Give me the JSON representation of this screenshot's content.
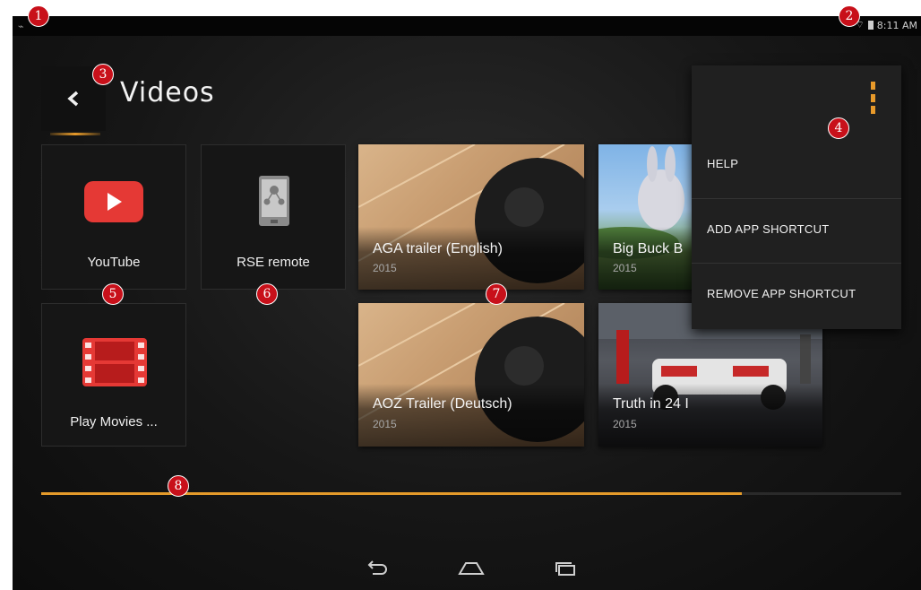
{
  "status_bar": {
    "time": "8:11 AM"
  },
  "header": {
    "title": "Videos"
  },
  "apps": [
    {
      "label": "YouTube",
      "icon": "youtube-icon"
    },
    {
      "label": "RSE remote",
      "icon": "rse-remote-icon"
    },
    {
      "label": "Play Movies ...",
      "icon": "film-icon"
    }
  ],
  "videos": [
    {
      "title": "AGA trailer (English)",
      "year": "2015"
    },
    {
      "title": "Big Buck B",
      "year": "2015"
    },
    {
      "title": "AOZ Trailer (Deutsch)",
      "year": "2015"
    },
    {
      "title": "Truth in 24 I",
      "year": "2015"
    }
  ],
  "menu": {
    "items": [
      {
        "label": "HELP"
      },
      {
        "label": "ADD APP SHORTCUT"
      },
      {
        "label": "REMOVE APP SHORTCUT"
      }
    ]
  },
  "scroll_progress": 0.815,
  "markers": [
    "1",
    "2",
    "3",
    "4",
    "5",
    "6",
    "7",
    "8"
  ],
  "colors": {
    "accent": "#e89a2a",
    "youtube_red": "#e53935",
    "marker_red": "#c8101a"
  }
}
